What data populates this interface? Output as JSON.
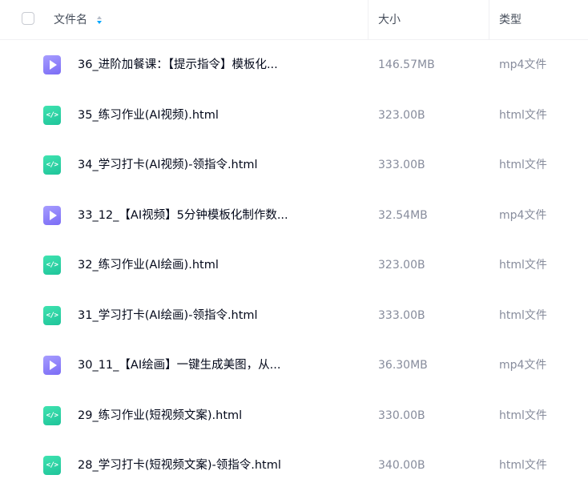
{
  "header": {
    "name_label": "文件名",
    "size_label": "大小",
    "type_label": "类型"
  },
  "files": [
    {
      "name": "36_进阶加餐课：【提示指令】模板化...",
      "size": "146.57MB",
      "type": "mp4文件",
      "icon": "video-file-icon"
    },
    {
      "name": "35_练习作业(AI视频).html",
      "size": "323.00B",
      "type": "html文件",
      "icon": "html-file-icon"
    },
    {
      "name": "34_学习打卡(AI视频)-领指令.html",
      "size": "333.00B",
      "type": "html文件",
      "icon": "html-file-icon"
    },
    {
      "name": "33_12_【AI视频】5分钟模板化制作数...",
      "size": "32.54MB",
      "type": "mp4文件",
      "icon": "video-file-icon"
    },
    {
      "name": "32_练习作业(AI绘画).html",
      "size": "323.00B",
      "type": "html文件",
      "icon": "html-file-icon"
    },
    {
      "name": "31_学习打卡(AI绘画)-领指令.html",
      "size": "333.00B",
      "type": "html文件",
      "icon": "html-file-icon"
    },
    {
      "name": "30_11_【AI绘画】一键生成美图，从...",
      "size": "36.30MB",
      "type": "mp4文件",
      "icon": "video-file-icon"
    },
    {
      "name": "29_练习作业(短视频文案).html",
      "size": "330.00B",
      "type": "html文件",
      "icon": "html-file-icon"
    },
    {
      "name": "28_学习打卡(短视频文案)-领指令.html",
      "size": "340.00B",
      "type": "html文件",
      "icon": "html-file-icon"
    }
  ]
}
